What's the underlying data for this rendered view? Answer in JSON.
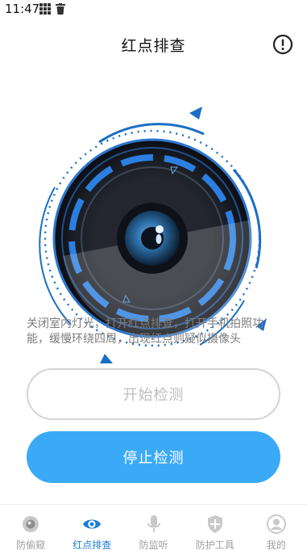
{
  "status_bar": {
    "time": "11:47",
    "icons": [
      "grid-icon",
      "trash-icon"
    ]
  },
  "header": {
    "title": "红点排查",
    "info_icon": "info-icon"
  },
  "instruction": "关闭室内灯光，打开红点排查，打开手机拍照功能，缓慢环绕四周，出现红点则疑似摄像头",
  "buttons": {
    "start": "开始检测",
    "stop": "停止检测"
  },
  "nav": {
    "items": [
      {
        "label": "防偷窥",
        "icon": "eye-lens-icon",
        "active": false
      },
      {
        "label": "红点排查",
        "icon": "eye-icon",
        "active": true
      },
      {
        "label": "防监听",
        "icon": "microphone-icon",
        "active": false
      },
      {
        "label": "防护工具",
        "icon": "shield-icon",
        "active": false
      },
      {
        "label": "我的",
        "icon": "user-icon",
        "active": false
      }
    ]
  },
  "colors": {
    "accent": "#1b7fd6",
    "button": "#3aaaf7",
    "muted": "#9e9e9e"
  }
}
